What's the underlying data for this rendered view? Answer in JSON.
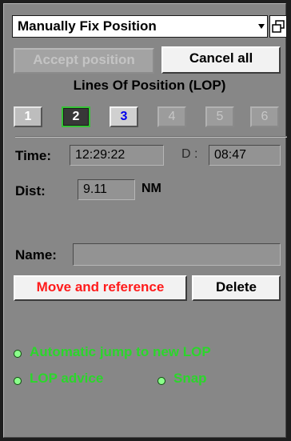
{
  "mode_select": {
    "value": "Manually Fix Position"
  },
  "buttons": {
    "accept": "Accept position",
    "cancel_all": "Cancel all",
    "move_reference": "Move and reference",
    "delete": "Delete"
  },
  "lop": {
    "heading": "Lines Of Position (LOP)",
    "items": [
      "1",
      "2",
      "3",
      "4",
      "5",
      "6"
    ],
    "selected": "2"
  },
  "fields": {
    "time_label": "Time:",
    "time_value": "12:29:22",
    "d_label": "D :",
    "d_value": "08:47",
    "dist_label": "Dist:",
    "dist_value": "9.11",
    "dist_unit": "NM",
    "name_label": "Name:",
    "name_value": ""
  },
  "options": {
    "auto_jump": "Automatic jump to new LOP",
    "lop_advice": "LOP advice",
    "snap": "Snap"
  },
  "colors": {
    "panel": "#878787",
    "option_text": "#2bd62b",
    "selected_border": "#36c236",
    "lop3_text": "#0000ee",
    "move_text": "#ff1b1b"
  }
}
